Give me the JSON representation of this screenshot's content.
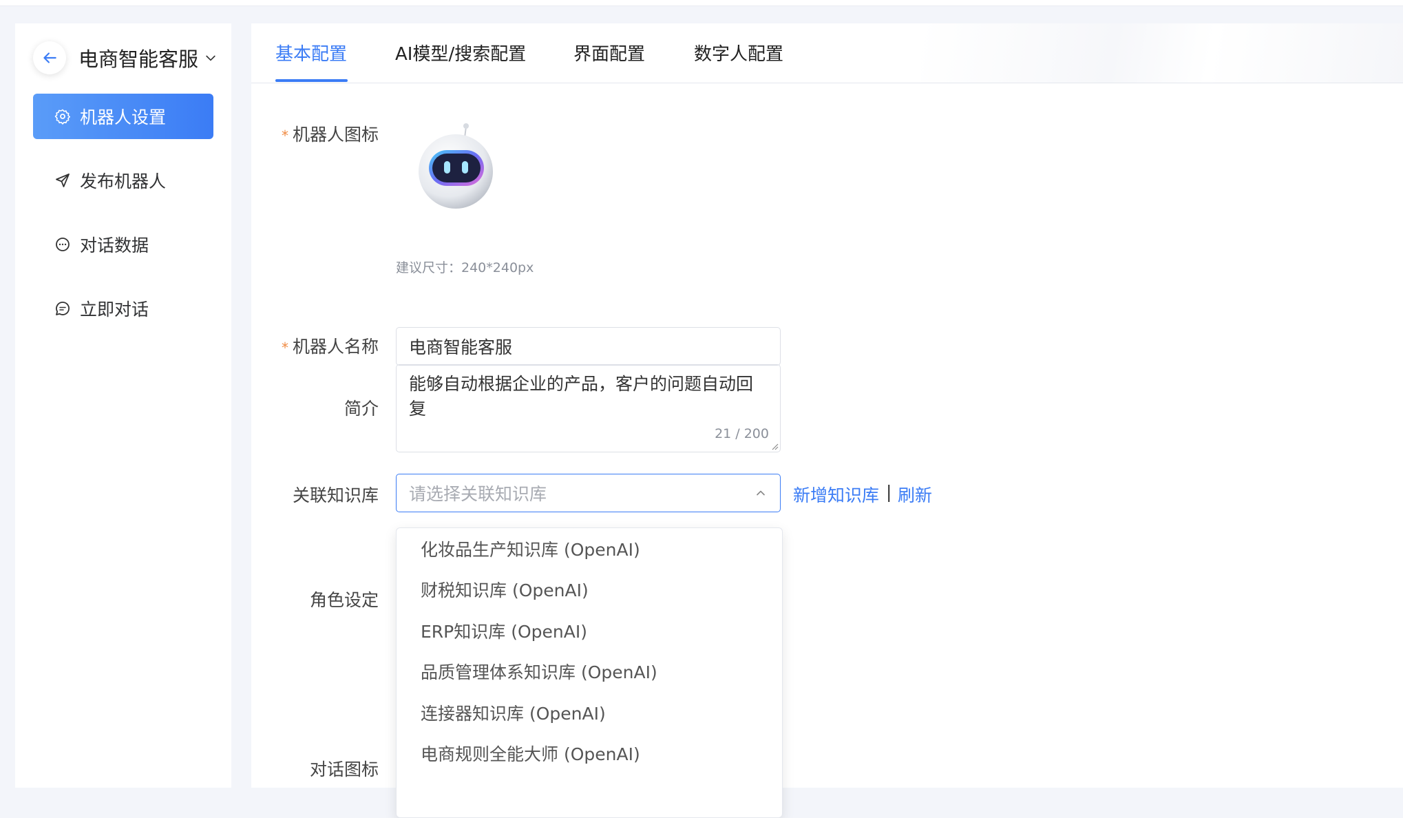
{
  "app": {
    "title": "电商智能客服"
  },
  "sidebar": {
    "items": [
      {
        "label": "机器人设置",
        "icon": "gear-icon",
        "active": true
      },
      {
        "label": "发布机器人",
        "icon": "send-icon",
        "active": false
      },
      {
        "label": "对话数据",
        "icon": "chat-icon",
        "active": false
      },
      {
        "label": "立即对话",
        "icon": "chat-bubble-icon",
        "active": false
      }
    ]
  },
  "tabs": [
    {
      "label": "基本配置",
      "active": true
    },
    {
      "label": "AI模型/搜索配置",
      "active": false
    },
    {
      "label": "界面配置",
      "active": false
    },
    {
      "label": "数字人配置",
      "active": false
    }
  ],
  "form": {
    "required_mark": "*",
    "icon_label": "机器人图标",
    "icon_hint": "建议尺寸：240*240px",
    "name_label": "机器人名称",
    "name_value": "电商智能客服",
    "intro_label": "简介",
    "intro_value": "能够自动根据企业的产品，客户的问题自动回复",
    "intro_counter": "21 / 200",
    "kb_label": "关联知识库",
    "kb_placeholder": "请选择关联知识库",
    "kb_add_link": "新增知识库",
    "kb_separator": "|",
    "kb_refresh_link": "刷新",
    "role_label": "角色设定",
    "chat_icon_label": "对话图标"
  },
  "dropdown": {
    "options": [
      "化妆品生产知识库 (OpenAI)",
      "财税知识库 (OpenAI)",
      "ERP知识库 (OpenAI)",
      "品质管理体系知识库 (OpenAI)",
      "连接器知识库 (OpenAI)",
      "电商规则全能大师 (OpenAI)"
    ]
  },
  "colors": {
    "accent": "#3b7cf5",
    "required": "#f08a43"
  }
}
